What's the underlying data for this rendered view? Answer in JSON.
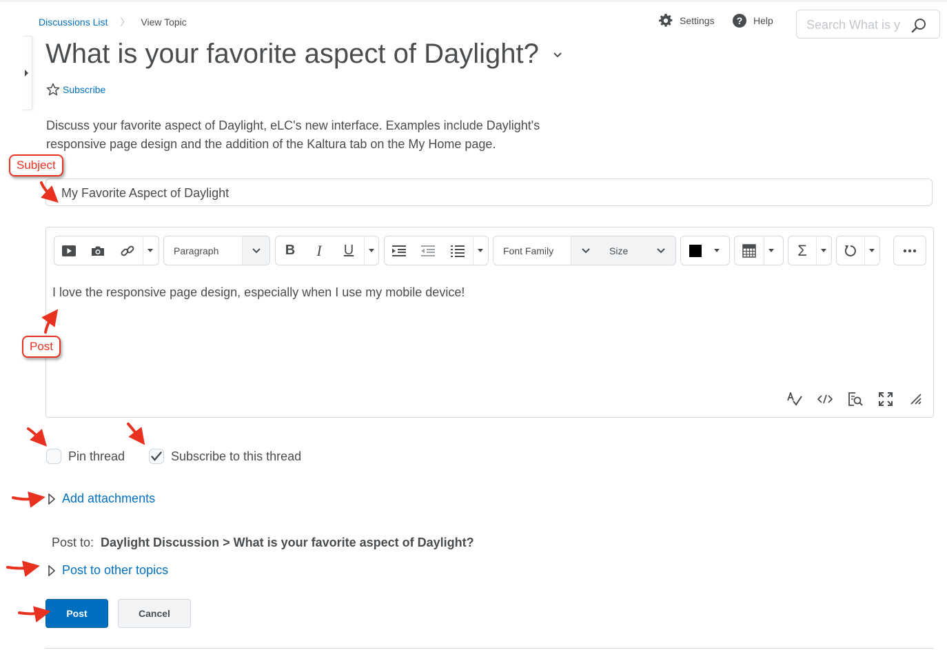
{
  "breadcrumbs": {
    "parent": "Discussions List",
    "current": "View Topic"
  },
  "header": {
    "settings_label": "Settings",
    "help_label": "Help",
    "search_placeholder": "Search What is your favorite aspect of Daylight?",
    "search_visible_text": "Search What is y"
  },
  "topic": {
    "title": "What is your favorite aspect of Daylight?",
    "subscribe_label": "Subscribe",
    "description": "Discuss your favorite aspect of Daylight, eLC's new interface. Examples include Daylight's responsive page design and the addition of the Kaltura tab on the My Home page."
  },
  "form": {
    "subject_value": "My Favorite Aspect of Daylight",
    "paragraph_select": "Paragraph",
    "font_family_select": "Font Family",
    "size_select": "Size",
    "bold_label": "B",
    "italic_label": "I",
    "underline_label": "U",
    "sigma_label": "Σ",
    "post_body": "I love the responsive page design, especially when I use my mobile device!",
    "pin_thread_label": "Pin thread",
    "pin_thread_checked": false,
    "subscribe_thread_label": "Subscribe to this thread",
    "subscribe_thread_checked": true,
    "add_attachments_label": "Add attachments",
    "post_to_prefix": "Post to:",
    "post_to_path": "Daylight Discussion > What is your favorite aspect of Daylight?",
    "post_other_topics_label": "Post to other topics",
    "post_button": "Post",
    "cancel_button": "Cancel"
  },
  "annotations": {
    "subject_callout": "Subject",
    "post_callout": "Post"
  },
  "colors": {
    "link": "#006fbf",
    "primary": "#006fbf",
    "text": "#494c4e",
    "annotation": "#e8321f"
  }
}
